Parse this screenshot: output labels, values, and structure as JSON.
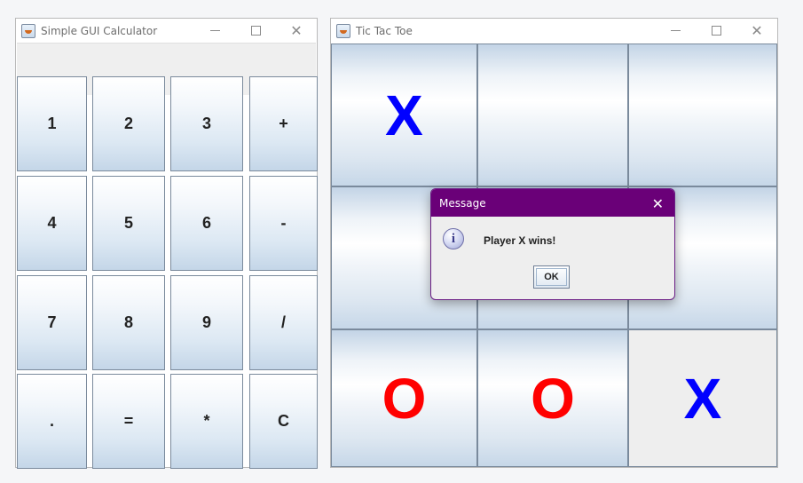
{
  "calculator": {
    "title": "Simple GUI Calculator",
    "buttons": [
      "1",
      "2",
      "3",
      "+",
      "4",
      "5",
      "6",
      "-",
      "7",
      "8",
      "9",
      "/",
      ".",
      "=",
      "*",
      "C"
    ]
  },
  "tictactoe": {
    "title": "Tic Tac Toe",
    "cells": [
      "X",
      "",
      "",
      "",
      "",
      "",
      "O",
      "O",
      "X"
    ],
    "colors": {
      "X": "#0000ff",
      "O": "#ff0000"
    }
  },
  "dialog": {
    "title": "Message",
    "message": "Player X wins!",
    "ok_label": "OK",
    "icon": "info-icon"
  },
  "window_controls": {
    "minimize": "minimize-icon",
    "maximize": "maximize-icon",
    "close": "close-icon"
  }
}
